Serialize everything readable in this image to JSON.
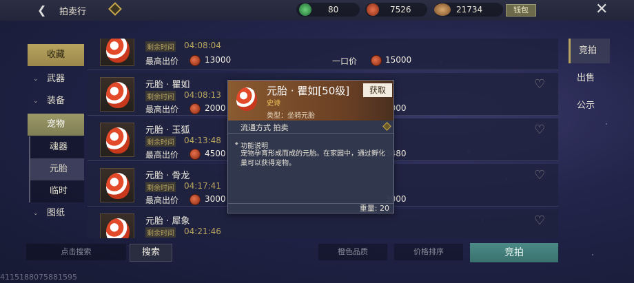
{
  "header": {
    "title": "拍卖行",
    "back_icon": "back-arrow-icon",
    "currencies": [
      {
        "icon": "jade-icon",
        "value": "80"
      },
      {
        "icon": "copper-coin-icon",
        "value": "7526"
      },
      {
        "icon": "bronze-shell-icon",
        "value": "21734"
      }
    ],
    "wallet_label": "钱包"
  },
  "nav": {
    "items": [
      {
        "label": "收藏",
        "style": "gold"
      },
      {
        "label": "武器",
        "chevron": true
      },
      {
        "label": "装备",
        "chevron": true
      },
      {
        "label": "宠物",
        "style": "pet"
      },
      {
        "label": "魂器",
        "sub": true
      },
      {
        "label": "元胎",
        "sub": true,
        "selected": true
      },
      {
        "label": "临时",
        "sub": true
      },
      {
        "label": "图纸",
        "chevron": true
      }
    ]
  },
  "list": {
    "time_label": "剩余时间",
    "bid_label": "最高出价",
    "buy_label": "一口价",
    "rows": [
      {
        "name": "",
        "time": "04:08:04",
        "bid": "13000",
        "buy": "15000"
      },
      {
        "name": "元胎 · 瞿如",
        "time": "04:08:13",
        "bid": "2000",
        "buy": "0000"
      },
      {
        "name": "元胎 · 玉狐",
        "time": "04:13:48",
        "bid": "4500",
        "buy": "3480"
      },
      {
        "name": "元胎 · 骨龙",
        "time": "04:17:41",
        "bid": "3000",
        "buy": "3000"
      },
      {
        "name": "元胎 · 犀象",
        "time": "04:21:46",
        "bid": "",
        "buy": ""
      }
    ]
  },
  "right_tabs": [
    "竞拍",
    "出售",
    "公示"
  ],
  "bottom": {
    "search_placeholder": "点击搜索",
    "search_button": "搜索",
    "quality_sort": "橙色品质",
    "price_sort": "价格排序",
    "bid_button": "竞拍"
  },
  "popup": {
    "name": "元胎 · 瞿如[50级]",
    "rarity": "史诗",
    "get_button": "获取",
    "type": "类型：坐骑元胎",
    "circulation": "流通方式   拍卖",
    "func_title": "功能说明",
    "desc": "宠物孕育形成而成的元胎。在家园中，通过孵化巢可以获得宠物。",
    "weight": "重量: 20"
  },
  "footer_id": "4115188075881595"
}
